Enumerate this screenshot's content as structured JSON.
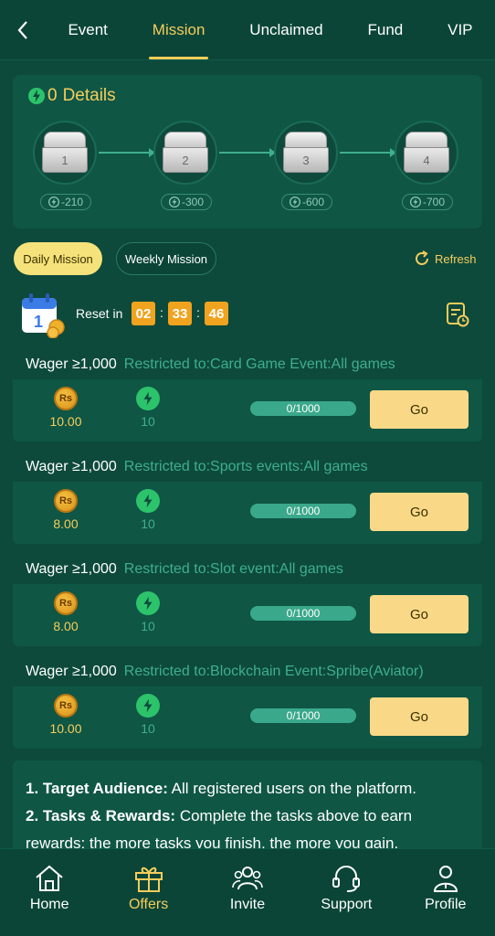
{
  "nav": {
    "tabs": [
      {
        "label": "Event"
      },
      {
        "label": "Mission"
      },
      {
        "label": "Unclaimed"
      },
      {
        "label": "Fund"
      },
      {
        "label": "VIP"
      }
    ],
    "active_tab": "Mission"
  },
  "details": {
    "energy_count": "0",
    "title": "Details",
    "chests": [
      {
        "number": "1",
        "cost": "-210"
      },
      {
        "number": "2",
        "cost": "-300"
      },
      {
        "number": "3",
        "cost": "-600"
      },
      {
        "number": "4",
        "cost": "-700"
      }
    ]
  },
  "mission_tabs": {
    "daily": "Daily Mission",
    "weekly": "Weekly Mission",
    "refresh": "Refresh"
  },
  "reset": {
    "label": "Reset in",
    "hours": "02",
    "minutes": "33",
    "seconds": "46"
  },
  "missions": [
    {
      "wager": "Wager ≥1,000",
      "restriction": "Restricted to:Card Game Event:All games",
      "cash": "10.00",
      "energy": "10",
      "progress": "0/1000",
      "progress_fraction": 0,
      "action": "Go"
    },
    {
      "wager": "Wager ≥1,000",
      "restriction": "Restricted to:Sports events:All games",
      "cash": "8.00",
      "energy": "10",
      "progress": "0/1000",
      "progress_fraction": 0,
      "action": "Go"
    },
    {
      "wager": "Wager ≥1,000",
      "restriction": "Restricted to:Slot event:All games",
      "cash": "8.00",
      "energy": "10",
      "progress": "0/1000",
      "progress_fraction": 0,
      "action": "Go"
    },
    {
      "wager": "Wager ≥1,000",
      "restriction": "Restricted to:Blockchain Event:Spribe(Aviator)",
      "cash": "10.00",
      "energy": "10",
      "progress": "0/1000",
      "progress_fraction": 0,
      "action": "Go"
    }
  ],
  "coin_symbol": "Rs",
  "rules": [
    {
      "heading": "1. Target Audience:",
      "text": " All registered users on the platform."
    },
    {
      "heading": "2. Tasks & Rewards:",
      "text": " Complete the tasks above to earn rewards; the more tasks you finish, the more you gain."
    }
  ],
  "bottom_nav": [
    {
      "label": "Home",
      "icon": "home-icon"
    },
    {
      "label": "Offers",
      "icon": "gift-icon"
    },
    {
      "label": "Invite",
      "icon": "users-icon"
    },
    {
      "label": "Support",
      "icon": "headset-icon"
    },
    {
      "label": "Profile",
      "icon": "profile-icon"
    }
  ],
  "colors": {
    "background": "#0d4a3c",
    "accent": "#f5cd5b",
    "green_text": "#3fae8e",
    "button": "#f9d988",
    "timer": "#f0a31f"
  }
}
